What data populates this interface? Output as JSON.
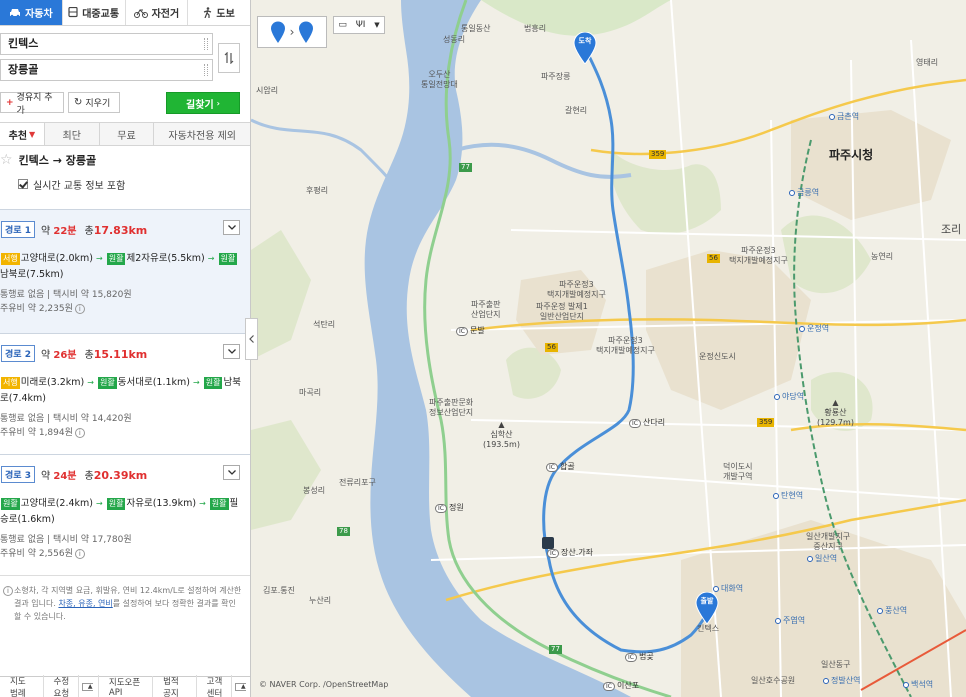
{
  "modes": [
    {
      "label": "자동차",
      "icon": "car-icon",
      "active": true
    },
    {
      "label": "대중교통",
      "icon": "bus-icon",
      "active": false
    },
    {
      "label": "자전거",
      "icon": "bicycle-icon",
      "active": false
    },
    {
      "label": "도보",
      "icon": "walk-icon",
      "active": false
    }
  ],
  "search": {
    "origin": "킨텍스",
    "destination": "장릉골"
  },
  "actions": {
    "add_via": "경유지 추가",
    "clear": "지우기",
    "find": "길찾기"
  },
  "options": [
    "추천",
    "최단",
    "무료",
    "자동차전용 제외"
  ],
  "route_title": "킨텍스 → 장릉골",
  "traffic_label": "실시간 교통 정보 포함",
  "routes": [
    {
      "label": "경로 1",
      "time_prefix": "약",
      "time": "22분",
      "dist_prefix": "총",
      "dist": "17.83km",
      "segments": [
        {
          "tag": "서행",
          "tag_color": "#f2b400",
          "road": "고양대로(2.0km)"
        },
        {
          "tag": "원활",
          "tag_color": "#24a74a",
          "road": "제2자유로(5.5km)"
        },
        {
          "tag": "원활",
          "tag_color": "#24a74a",
          "road": "남북로(7.5km)"
        }
      ],
      "toll": "통행료 없음",
      "taxi": "택시비 약 15,820원",
      "fuel": "주유비 약 2,235원"
    },
    {
      "label": "경로 2",
      "time_prefix": "약",
      "time": "26분",
      "dist_prefix": "총",
      "dist": "15.11km",
      "segments": [
        {
          "tag": "서행",
          "tag_color": "#f2b400",
          "road": "미래로(3.2km)"
        },
        {
          "tag": "원활",
          "tag_color": "#24a74a",
          "road": "동서대로(1.1km)"
        },
        {
          "tag": "원활",
          "tag_color": "#24a74a",
          "road": "남북로(7.4km)"
        }
      ],
      "toll": "통행료 없음",
      "taxi": "택시비 약 14,420원",
      "fuel": "주유비 약 1,894원"
    },
    {
      "label": "경로 3",
      "time_prefix": "약",
      "time": "24분",
      "dist_prefix": "총",
      "dist": "20.39km",
      "segments": [
        {
          "tag": "원활",
          "tag_color": "#24a74a",
          "road": "고양대로(2.4km)"
        },
        {
          "tag": "원활",
          "tag_color": "#24a74a",
          "road": "자유로(13.9km)"
        },
        {
          "tag": "원활",
          "tag_color": "#24a74a",
          "road": "필승로(1.6km)"
        }
      ],
      "toll": "통행료 없음",
      "taxi": "택시비 약 17,780원",
      "fuel": "주유비 약 2,556원"
    }
  ],
  "notice": {
    "text1": "소형차, 각 지역별 요금, 휘발유, 연비 12.4km/L로 설정하여 계산한 결과 입니다.",
    "link": "차종, 유종, 연비",
    "text2": "를 설정하여 보다 정확한 결과를 확인할 수 있습니다."
  },
  "footer": [
    "지도범례",
    "수정요청",
    "지도오픈API",
    "법적공지",
    "고객센터"
  ],
  "map": {
    "start_pin": "출발",
    "end_pin": "도착",
    "copyright": "© NAVER Corp. /OpenStreetMap",
    "city": "파주시청",
    "labels": {
      "tonggil": "통일동산",
      "beopheung": "법흥리",
      "seongdong": "성동리",
      "odusan": "오두산\n통일전망대",
      "paju_jangneung": "파주장릉",
      "galhyeon": "갈현리",
      "siamri": "시암리",
      "geumchon": "금촌역",
      "geumneung": "금릉역",
      "yeongtae": "영태리",
      "hoopyeong": "후평리",
      "jori": "조리",
      "nongyeon": "농연리",
      "paju_unjeong3_1": "파주운정3\n택지개발예정지구",
      "paju_chul": "파주출판\n산업단지",
      "paju_unjeong3_2": "파주운정3\n택지개발예정지구",
      "paju_unjeong_bp": "파주운정 발제1\n일반산업단지",
      "paju_unjeong3_3": "파주운정3\n택지개발예정지구",
      "unjeong_city": "운정신도시",
      "unjeong_station": "운정역",
      "yadang": "야당역",
      "hwangryong": "황룡산\n(129.7m)",
      "seoktan": "석탄리",
      "muleul": "문발",
      "paju_chulpan2": "파주출판문화\n정보산업단지",
      "simhaksan": "심학산\n(193.5m)",
      "gyeonghwan": "산남리",
      "sandari": "산다리",
      "hapgol": "합골",
      "machok": "마곡리",
      "tanhyeon": "탄현역",
      "ilsanbook": "덕이도시\n개발구역",
      "sinwon": "성동리",
      "seonggdong2": "전류리포구",
      "jeongwon": "정원",
      "bongseong": "봉성리",
      "jangsan": "장산.가좌",
      "kimpo": "김포.통진",
      "nusan": "누산리",
      "ilsan_station": "일산역",
      "daehwa": "대화역",
      "ilsan_plan": "일산개발지구\n중산지구",
      "jueop": "주엽역",
      "pungsan": "풍산역",
      "kintex_lbl": "킨텍스",
      "beopgot": "법곶",
      "isanpo": "이산포",
      "ilsan_lake": "일산호수공원",
      "jeongbal": "정발산역",
      "baekseok": "백석역",
      "ilsan_dong": "일산동구"
    },
    "road_shields": [
      "77",
      "359",
      "56",
      "56",
      "359",
      "78",
      "77"
    ]
  }
}
